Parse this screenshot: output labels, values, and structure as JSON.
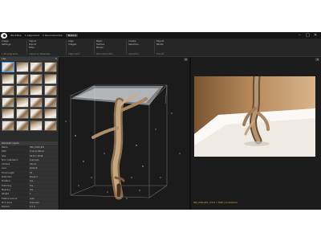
{
  "window": {
    "tabs": [
      {
        "label": "Workflow"
      },
      {
        "label": "1 Alignment"
      },
      {
        "label": "2 Reconstruction"
      },
      {
        "label": "Texture",
        "active": true
      }
    ],
    "controls": {
      "minimize": "–",
      "maximize": "□",
      "close": "✕"
    }
  },
  "ribbon": {
    "groups": [
      {
        "items": [
          "Image",
          "Settings"
        ],
        "label": "1 Photographs"
      },
      {
        "items": [
          "Import",
          "Export",
          "Filter"
        ],
        "label": "Import & Metadata"
      },
      {
        "items": [
          "Align",
          "Images"
        ],
        "label": "Alignment"
      },
      {
        "items": [
          "Mesh",
          "Texture",
          "Model"
        ],
        "label": "Reconstruction"
      },
      {
        "items": [
          "Create",
          "Selection"
        ],
        "label": "Selection"
      },
      {
        "items": [
          "Export",
          "Model"
        ],
        "label": "Export"
      }
    ]
  },
  "left": {
    "images_header": "1Ds",
    "thumb_count": 24,
    "props_header": "Selected inputs",
    "properties": [
      {
        "k": "Name",
        "v": "IMG_0000.JPG"
      },
      {
        "k": "Path",
        "v": "C:\\Scan\\Wood"
      },
      {
        "k": "Size",
        "v": "5472 x 3648"
      },
      {
        "k": "Prior calibration",
        "v": "Unknown"
      },
      {
        "k": "Camera",
        "v": "Canon"
      },
      {
        "k": "Lens",
        "v": "Default"
      },
      {
        "k": "Focal length",
        "v": "35"
      },
      {
        "k": "Distortion",
        "v": "Brown3"
      },
      {
        "k": "Enabled",
        "v": "Yes"
      },
      {
        "k": "Texturing",
        "v": "Yes"
      },
      {
        "k": "Meshing",
        "v": "Yes"
      },
      {
        "k": "Weight",
        "v": "1"
      },
      {
        "k": "Feature source",
        "v": "Auto"
      },
      {
        "k": "Prior pose",
        "v": "Unknown"
      },
      {
        "k": "Position",
        "v": "0 0 0"
      },
      {
        "k": "Rotation",
        "v": "0 0 0"
      },
      {
        "k": "Accuracy",
        "v": "1"
      },
      {
        "k": "Exposure",
        "v": "0"
      },
      {
        "k": "Group",
        "v": "1"
      },
      {
        "k": "Component",
        "v": "1"
      }
    ],
    "legend": [
      {
        "label": "Component",
        "color": "#8fd18f"
      },
      {
        "label": "Alignment",
        "color": "#6fa8ff"
      },
      {
        "label": "Reconstruction region",
        "color": "#ffd35c"
      },
      {
        "label": "Ground plane",
        "color": "#ff7a7a"
      }
    ]
  },
  "view3d": {
    "close": "✕"
  },
  "view2d": {
    "close": "✕",
    "status": "IMG_0000.JPG | 5472 x 3648 | Undistorted"
  },
  "colors": {
    "accent": "#3ba0ff",
    "app_bg": "#1f1f1f",
    "status": "#d8a040"
  }
}
